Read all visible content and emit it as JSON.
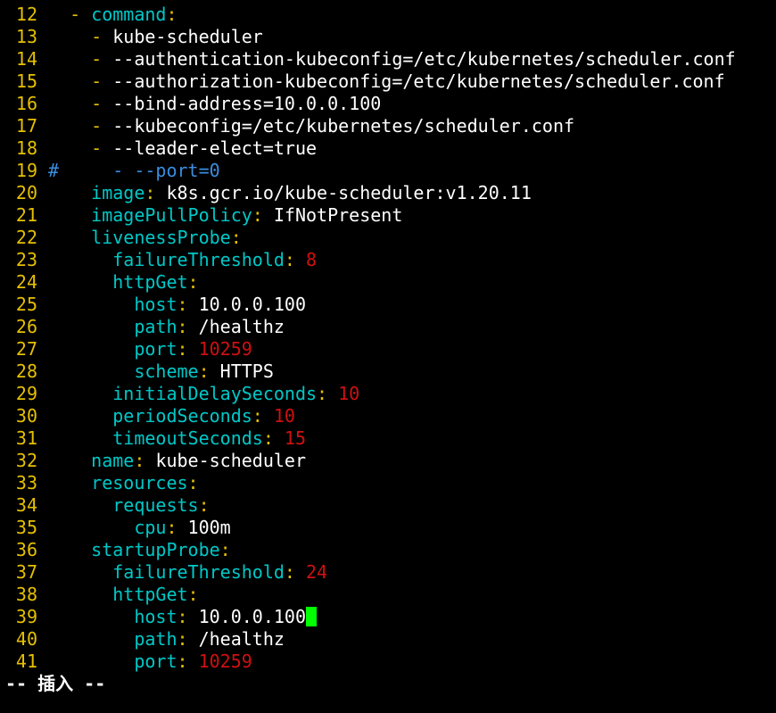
{
  "colors": {
    "background": "#000000",
    "line_number": "#e5c000",
    "dash": "#e5c000",
    "key": "#00c8c8",
    "string": "#ffffff",
    "number": "#d01010",
    "comment": "#3a8de0",
    "cursor": "#00ff00"
  },
  "lines": [
    {
      "n": "12",
      "segs": [
        {
          "t": "  ",
          "c": "s"
        },
        {
          "t": "- ",
          "c": "d"
        },
        {
          "t": "command",
          "c": "k"
        },
        {
          "t": ":",
          "c": "p"
        }
      ]
    },
    {
      "n": "13",
      "segs": [
        {
          "t": "    ",
          "c": "s"
        },
        {
          "t": "- ",
          "c": "d"
        },
        {
          "t": "kube-scheduler",
          "c": "s"
        }
      ]
    },
    {
      "n": "14",
      "segs": [
        {
          "t": "    ",
          "c": "s"
        },
        {
          "t": "- ",
          "c": "d"
        },
        {
          "t": "--authentication-kubeconfig=/etc/kubernetes/scheduler.conf",
          "c": "s"
        }
      ]
    },
    {
      "n": "15",
      "segs": [
        {
          "t": "    ",
          "c": "s"
        },
        {
          "t": "- ",
          "c": "d"
        },
        {
          "t": "--authorization-kubeconfig=/etc/kubernetes/scheduler.conf",
          "c": "s"
        }
      ]
    },
    {
      "n": "16",
      "segs": [
        {
          "t": "    ",
          "c": "s"
        },
        {
          "t": "- ",
          "c": "d"
        },
        {
          "t": "--bind-address=10.0.0.100",
          "c": "s"
        }
      ]
    },
    {
      "n": "17",
      "segs": [
        {
          "t": "    ",
          "c": "s"
        },
        {
          "t": "- ",
          "c": "d"
        },
        {
          "t": "--kubeconfig=/etc/kubernetes/scheduler.conf",
          "c": "s"
        }
      ]
    },
    {
      "n": "18",
      "segs": [
        {
          "t": "    ",
          "c": "s"
        },
        {
          "t": "- ",
          "c": "d"
        },
        {
          "t": "--leader-elect=true",
          "c": "s"
        }
      ]
    },
    {
      "n": "19",
      "segs": [
        {
          "t": "#     - --port=0",
          "c": "m"
        }
      ]
    },
    {
      "n": "20",
      "segs": [
        {
          "t": "    ",
          "c": "s"
        },
        {
          "t": "image",
          "c": "k"
        },
        {
          "t": ": ",
          "c": "p"
        },
        {
          "t": "k8s.gcr.io/kube-scheduler:v1.20.11",
          "c": "s"
        }
      ]
    },
    {
      "n": "21",
      "segs": [
        {
          "t": "    ",
          "c": "s"
        },
        {
          "t": "imagePullPolicy",
          "c": "k"
        },
        {
          "t": ": ",
          "c": "p"
        },
        {
          "t": "IfNotPresent",
          "c": "s"
        }
      ]
    },
    {
      "n": "22",
      "segs": [
        {
          "t": "    ",
          "c": "s"
        },
        {
          "t": "livenessProbe",
          "c": "k"
        },
        {
          "t": ":",
          "c": "p"
        }
      ]
    },
    {
      "n": "23",
      "segs": [
        {
          "t": "      ",
          "c": "s"
        },
        {
          "t": "failureThreshold",
          "c": "k"
        },
        {
          "t": ": ",
          "c": "p"
        },
        {
          "t": "8",
          "c": "n"
        }
      ]
    },
    {
      "n": "24",
      "segs": [
        {
          "t": "      ",
          "c": "s"
        },
        {
          "t": "httpGet",
          "c": "k"
        },
        {
          "t": ":",
          "c": "p"
        }
      ]
    },
    {
      "n": "25",
      "segs": [
        {
          "t": "        ",
          "c": "s"
        },
        {
          "t": "host",
          "c": "k"
        },
        {
          "t": ": ",
          "c": "p"
        },
        {
          "t": "10.0.0.100",
          "c": "s"
        }
      ]
    },
    {
      "n": "26",
      "segs": [
        {
          "t": "        ",
          "c": "s"
        },
        {
          "t": "path",
          "c": "k"
        },
        {
          "t": ": ",
          "c": "p"
        },
        {
          "t": "/healthz",
          "c": "s"
        }
      ]
    },
    {
      "n": "27",
      "segs": [
        {
          "t": "        ",
          "c": "s"
        },
        {
          "t": "port",
          "c": "k"
        },
        {
          "t": ": ",
          "c": "p"
        },
        {
          "t": "10259",
          "c": "n"
        }
      ]
    },
    {
      "n": "28",
      "segs": [
        {
          "t": "        ",
          "c": "s"
        },
        {
          "t": "scheme",
          "c": "k"
        },
        {
          "t": ": ",
          "c": "p"
        },
        {
          "t": "HTTPS",
          "c": "s"
        }
      ]
    },
    {
      "n": "29",
      "segs": [
        {
          "t": "      ",
          "c": "s"
        },
        {
          "t": "initialDelaySeconds",
          "c": "k"
        },
        {
          "t": ": ",
          "c": "p"
        },
        {
          "t": "10",
          "c": "n"
        }
      ]
    },
    {
      "n": "30",
      "segs": [
        {
          "t": "      ",
          "c": "s"
        },
        {
          "t": "periodSeconds",
          "c": "k"
        },
        {
          "t": ": ",
          "c": "p"
        },
        {
          "t": "10",
          "c": "n"
        }
      ]
    },
    {
      "n": "31",
      "segs": [
        {
          "t": "      ",
          "c": "s"
        },
        {
          "t": "timeoutSeconds",
          "c": "k"
        },
        {
          "t": ": ",
          "c": "p"
        },
        {
          "t": "15",
          "c": "n"
        }
      ]
    },
    {
      "n": "32",
      "segs": [
        {
          "t": "    ",
          "c": "s"
        },
        {
          "t": "name",
          "c": "k"
        },
        {
          "t": ": ",
          "c": "p"
        },
        {
          "t": "kube-scheduler",
          "c": "s"
        }
      ]
    },
    {
      "n": "33",
      "segs": [
        {
          "t": "    ",
          "c": "s"
        },
        {
          "t": "resources",
          "c": "k"
        },
        {
          "t": ":",
          "c": "p"
        }
      ]
    },
    {
      "n": "34",
      "segs": [
        {
          "t": "      ",
          "c": "s"
        },
        {
          "t": "requests",
          "c": "k"
        },
        {
          "t": ":",
          "c": "p"
        }
      ]
    },
    {
      "n": "35",
      "segs": [
        {
          "t": "        ",
          "c": "s"
        },
        {
          "t": "cpu",
          "c": "k"
        },
        {
          "t": ": ",
          "c": "p"
        },
        {
          "t": "100m",
          "c": "s"
        }
      ]
    },
    {
      "n": "36",
      "segs": [
        {
          "t": "    ",
          "c": "s"
        },
        {
          "t": "startupProbe",
          "c": "k"
        },
        {
          "t": ":",
          "c": "p"
        }
      ]
    },
    {
      "n": "37",
      "segs": [
        {
          "t": "      ",
          "c": "s"
        },
        {
          "t": "failureThreshold",
          "c": "k"
        },
        {
          "t": ": ",
          "c": "p"
        },
        {
          "t": "24",
          "c": "n"
        }
      ]
    },
    {
      "n": "38",
      "segs": [
        {
          "t": "      ",
          "c": "s"
        },
        {
          "t": "httpGet",
          "c": "k"
        },
        {
          "t": ":",
          "c": "p"
        }
      ]
    },
    {
      "n": "39",
      "segs": [
        {
          "t": "        ",
          "c": "s"
        },
        {
          "t": "host",
          "c": "k"
        },
        {
          "t": ": ",
          "c": "p"
        },
        {
          "t": "10.0.0.100",
          "c": "s"
        }
      ],
      "cursor": true
    },
    {
      "n": "40",
      "segs": [
        {
          "t": "        ",
          "c": "s"
        },
        {
          "t": "path",
          "c": "k"
        },
        {
          "t": ": ",
          "c": "p"
        },
        {
          "t": "/healthz",
          "c": "s"
        }
      ]
    },
    {
      "n": "41",
      "segs": [
        {
          "t": "        ",
          "c": "s"
        },
        {
          "t": "port",
          "c": "k"
        },
        {
          "t": ": ",
          "c": "p"
        },
        {
          "t": "10259",
          "c": "n"
        }
      ]
    }
  ],
  "status": {
    "mode_text": "-- 插入 --"
  }
}
